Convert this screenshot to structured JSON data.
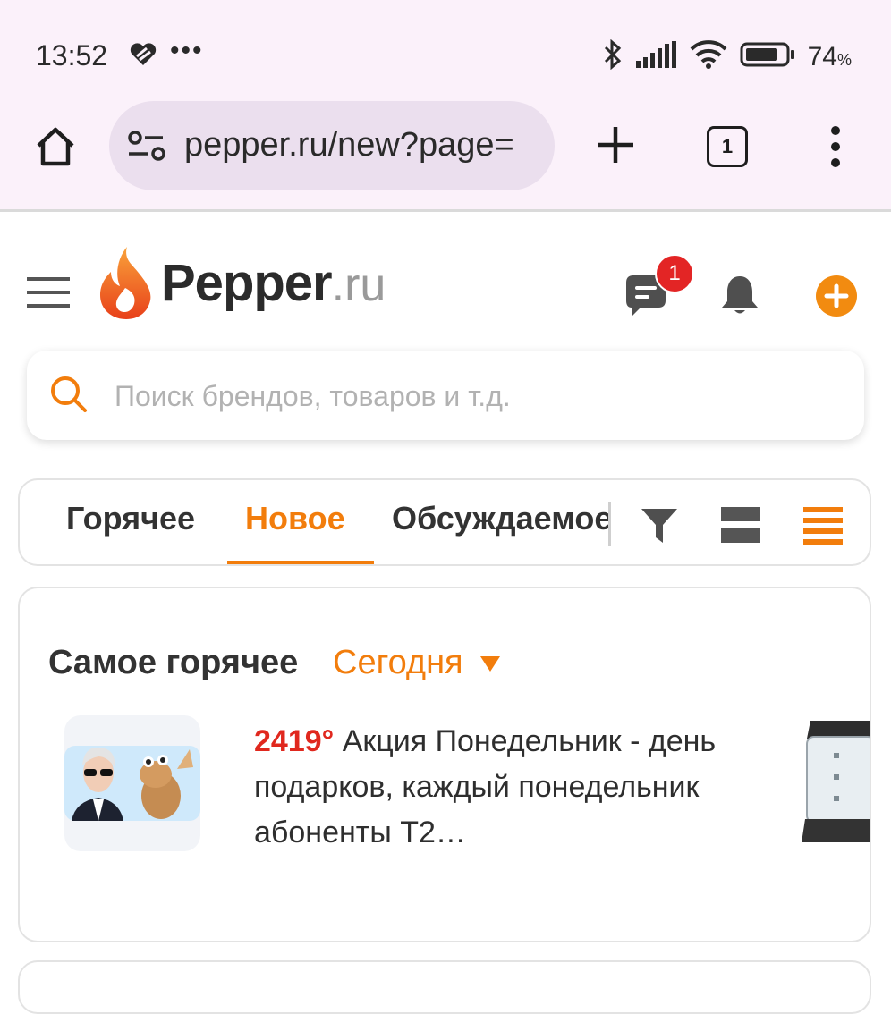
{
  "status_bar": {
    "time": "13:52",
    "battery_percent": "74",
    "battery_unit": "%"
  },
  "browser": {
    "url": "pepper.ru/new?page=",
    "tab_count": "1"
  },
  "site": {
    "logo_word": "Pepper",
    "logo_tld": ".ru",
    "messages_badge": "1"
  },
  "search": {
    "placeholder": "Поиск брендов, товаров и т.д."
  },
  "tabs": [
    {
      "label": "Горячее",
      "active": false
    },
    {
      "label": "Новое",
      "active": true
    },
    {
      "label": "Обсуждаемое",
      "active": false
    }
  ],
  "hottest": {
    "title": "Самое горячее",
    "period": "Сегодня",
    "deal": {
      "temperature": "2419°",
      "text": "Акция Понедельник - день подарков, каждый понедельник абоненты Т2…"
    }
  },
  "colors": {
    "accent": "#f27d0c",
    "hot": "#e0281e",
    "chrome_bg": "#fbf1fa",
    "badge": "#e32525"
  },
  "icons": [
    "heart-icon",
    "bluetooth-icon",
    "signal-icon",
    "wifi-icon",
    "battery-icon",
    "home-icon",
    "site-settings-icon",
    "plus-icon",
    "tabs-icon",
    "more-vert-icon",
    "hamburger-icon",
    "pepper-flame-icon",
    "chat-icon",
    "bell-icon",
    "add-deal-icon",
    "search-icon",
    "filter-icon",
    "card-view-icon",
    "list-view-icon",
    "caret-down-icon"
  ]
}
